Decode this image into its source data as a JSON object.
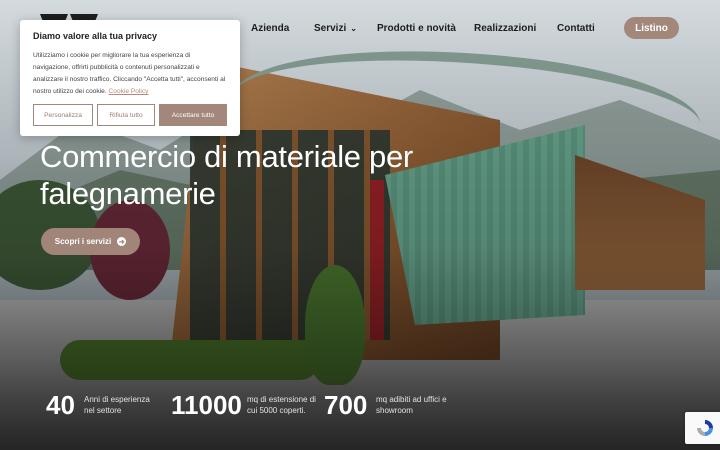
{
  "nav": {
    "items": [
      {
        "label": "Azienda"
      },
      {
        "label": "Servizi"
      },
      {
        "label": "Prodotti e novità"
      },
      {
        "label": "Realizzazioni"
      },
      {
        "label": "Contatti"
      }
    ],
    "listino_label": "Listino"
  },
  "hero": {
    "title": "Commercio di materiale per falegnamerie",
    "cta_label": "Scopri i servizi"
  },
  "stats": [
    {
      "value": "40",
      "label": "Anni di esperienza nel settore"
    },
    {
      "value": "11000",
      "label": "mq di estensione di cui 5000 coperti."
    },
    {
      "value": "700",
      "label": "mq adibiti ad uffici e showroom"
    }
  ],
  "cookie": {
    "title": "Diamo valore alla tua privacy",
    "text": "Utilizziamo i cookie per migliorare la tua esperienza di navigazione, offrirti pubblicità o contenuti personalizzati e analizzare il nostro traffico. Cliccando \"Accetta tutti\", acconsenti al nostro utilizzo dei cookie.",
    "link": "Cookie Policy",
    "buttons": {
      "customize": "Personalizza",
      "reject": "Rifiuta tutto",
      "accept": "Accettare tutto"
    }
  },
  "colors": {
    "accent": "#a3877a",
    "text_dark": "#1d1d1d"
  }
}
